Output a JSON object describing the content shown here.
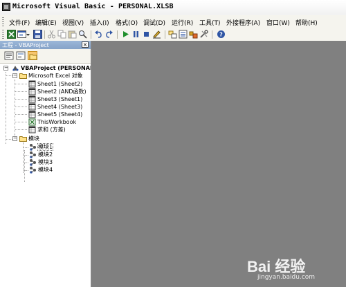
{
  "window": {
    "title": "Microsoft Visual Basic - PERSONAL.XLSB"
  },
  "menu": {
    "items": [
      {
        "label": "文件(F)"
      },
      {
        "label": "编辑(E)"
      },
      {
        "label": "视图(V)"
      },
      {
        "label": "插入(I)"
      },
      {
        "label": "格式(O)"
      },
      {
        "label": "调试(D)"
      },
      {
        "label": "运行(R)"
      },
      {
        "label": "工具(T)"
      },
      {
        "label": "外接程序(A)"
      },
      {
        "label": "窗口(W)"
      },
      {
        "label": "帮助(H)"
      }
    ]
  },
  "toolbar": {
    "icons": [
      "excel-icon",
      "insert-userform-icon",
      "save-icon",
      "cut-icon",
      "copy-icon",
      "paste-icon",
      "find-icon",
      "undo-icon",
      "redo-icon",
      "run-icon",
      "break-icon",
      "reset-icon",
      "design-mode-icon",
      "project-explorer-icon",
      "properties-icon",
      "object-browser-icon",
      "toolbox-icon",
      "help-icon"
    ]
  },
  "project_panel": {
    "title": "工程 - VBAProject",
    "close_label": "×",
    "tree": {
      "root": "VBAProject (PERSONAL.XLSB)",
      "excel_objects_folder": "Microsoft Excel 对象",
      "excel_objects": [
        "Sheet1 (Sheet2)",
        "Sheet2 (AND函数)",
        "Sheet3 (Sheet1)",
        "Sheet4 (Sheet3)",
        "Sheet5 (Sheet4)",
        "ThisWorkbook",
        "求和 (方差)"
      ],
      "modules_folder": "模块",
      "modules": [
        "模块1",
        "模块2",
        "模块3",
        "模块4"
      ]
    }
  },
  "watermark": {
    "logo": "Bai 经验",
    "url": "jingyan.baidu.com"
  },
  "colors": {
    "workspace": "#808080",
    "panel_header": "#9cb7d9",
    "toolbar_bg": "#f5f4ee"
  }
}
